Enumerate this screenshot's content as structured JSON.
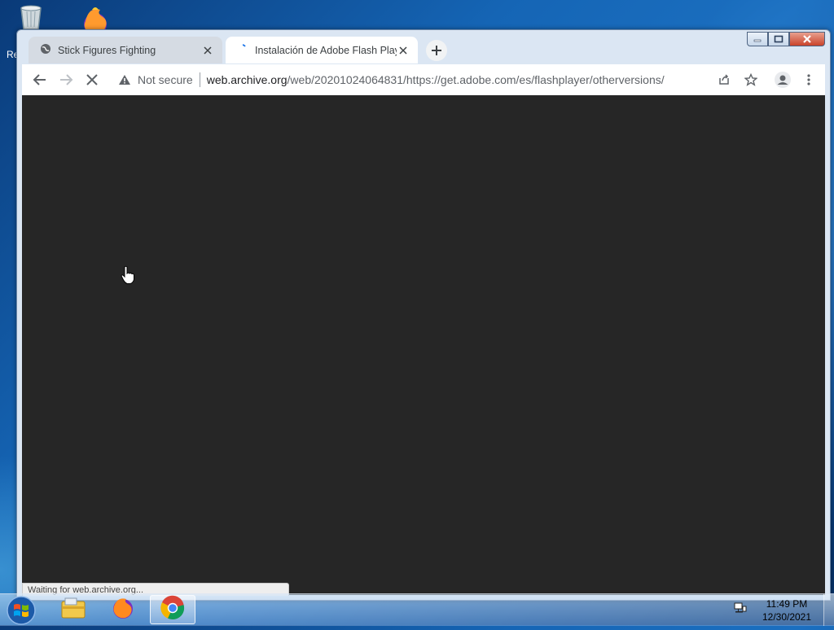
{
  "desktop": {
    "icons": [
      "recycle-bin-icon",
      "firefox-icon"
    ],
    "partial_label": "Re"
  },
  "browser": {
    "tabs": [
      {
        "title": "Stick Figures Fighting",
        "icon": "globe-icon",
        "active": false
      },
      {
        "title": "Instalación de Adobe Flash Player",
        "icon": "loading-spinner-icon",
        "active": true
      }
    ],
    "toolbar": {
      "security_label": "Not secure",
      "url_host": "web.archive.org",
      "url_path": "/web/20201024064831/https://get.adobe.com/es/flashplayer/otherversions/"
    },
    "status_text": "Waiting for web.archive.org..."
  },
  "taskbar": {
    "apps": [
      "windows-explorer-icon",
      "firefox-icon",
      "chrome-icon"
    ],
    "active_app": "chrome-icon",
    "time": "11:49 PM",
    "date": "12/30/2021"
  },
  "colors": {
    "content_bg": "#262626",
    "desktop_bg": "#1565b5",
    "tab_active": "#ffffff"
  }
}
